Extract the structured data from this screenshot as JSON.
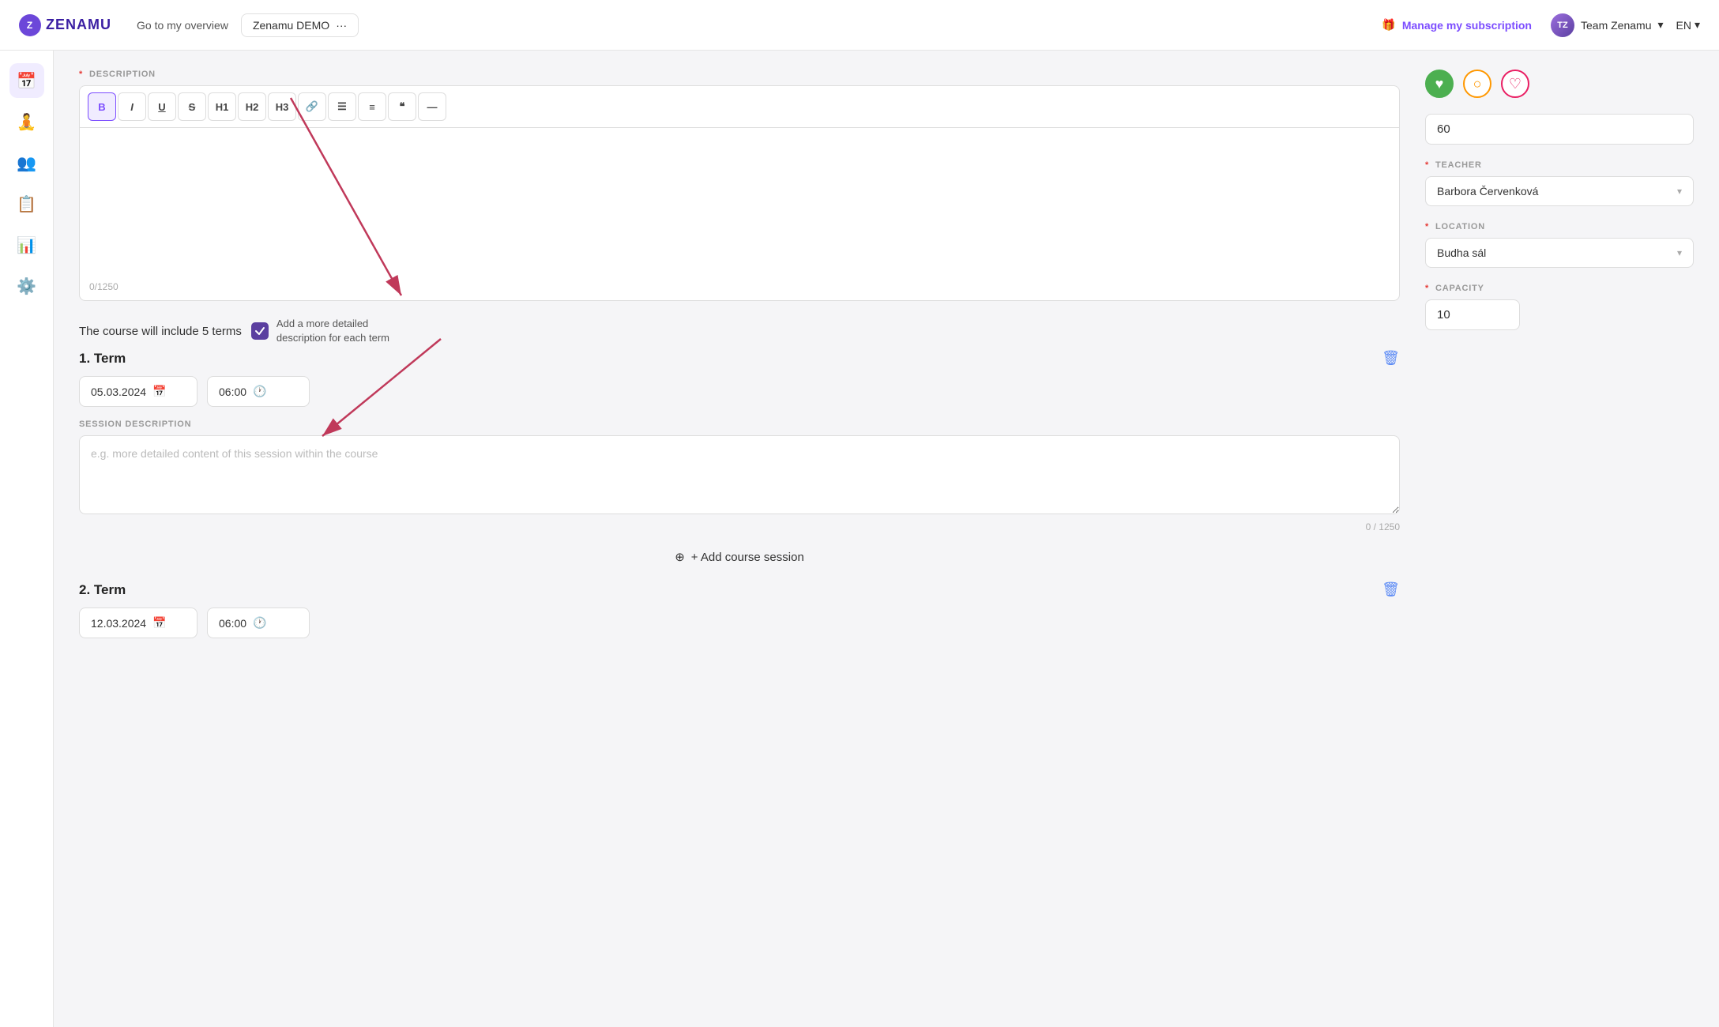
{
  "app": {
    "logo_text": "ZENAMU",
    "nav_overview": "Go to my overview",
    "workspace_name": "Zenamu DEMO",
    "workspace_more": "...",
    "manage_subscription": "Manage my subscription",
    "team_name": "Team Zenamu",
    "lang": "EN"
  },
  "sidebar": {
    "icons": [
      {
        "name": "calendar-icon",
        "symbol": "📅"
      },
      {
        "name": "meditation-icon",
        "symbol": "🧘"
      },
      {
        "name": "users-icon",
        "symbol": "👥"
      },
      {
        "name": "clipboard-icon",
        "symbol": "📋"
      },
      {
        "name": "chart-icon",
        "symbol": "📊"
      },
      {
        "name": "settings-icon",
        "symbol": "⚙️"
      }
    ]
  },
  "editor": {
    "description_label": "DESCRIPTION",
    "required": "*",
    "toolbar": {
      "bold": "B",
      "italic": "I",
      "underline": "U",
      "strikethrough": "S",
      "h1": "H1",
      "h2": "H2",
      "h3": "H3",
      "link": "🔗",
      "ul": "≡",
      "ol": "≣",
      "quote": "❝",
      "hr": "—"
    },
    "char_count": "0/1250"
  },
  "course": {
    "terms_text": "The course will include 5 terms",
    "checkbox_label": "Add a more detailed description for each term",
    "add_session_btn": "+ Add course session"
  },
  "terms": [
    {
      "number": "1",
      "title": "Term",
      "date": "05.03.2024",
      "time": "06:00",
      "session_desc_label": "SESSION DESCRIPTION",
      "session_placeholder": "e.g. more detailed content of this session within the course",
      "session_char_count": "0 / 1250"
    },
    {
      "number": "2",
      "title": "Term",
      "date": "12.03.2024",
      "time": "06:00"
    }
  ],
  "right_panel": {
    "capacity_value": "60",
    "teacher_label": "TEACHER",
    "teacher_value": "Barbora Červenková",
    "location_label": "LOCATION",
    "location_value": "Budha sál",
    "capacity_label": "CAPACITY",
    "capacity_num": "10",
    "reactions": [
      "green-heart",
      "orange-circle",
      "pink-heart"
    ]
  }
}
